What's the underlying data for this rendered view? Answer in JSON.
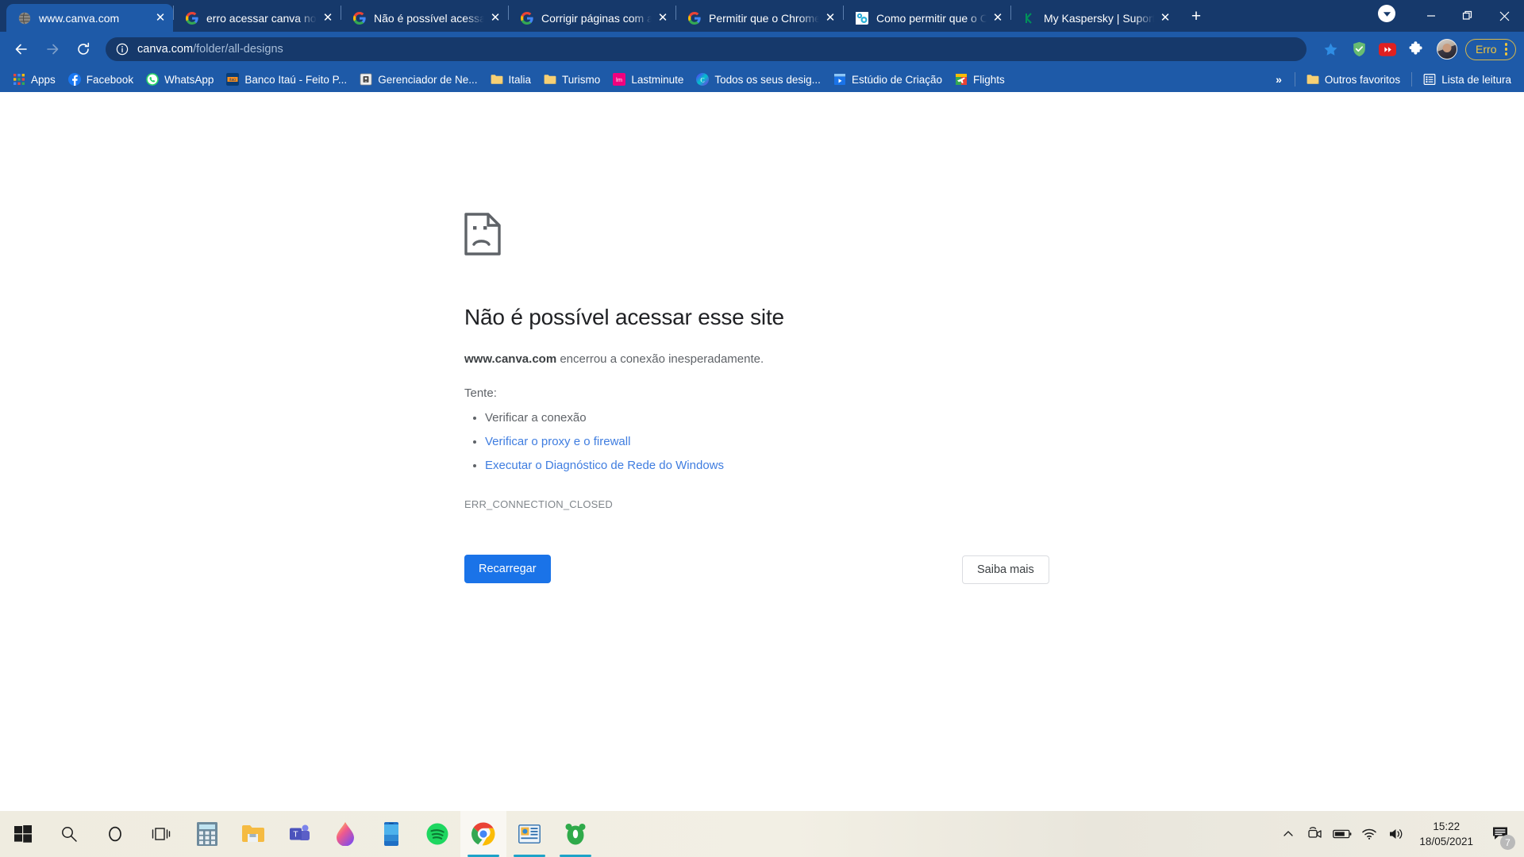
{
  "window": {
    "minimize_label": "Minimizar",
    "restore_label": "Restaurar",
    "close_label": "Fechar"
  },
  "tabs": [
    {
      "title": "www.canva.com",
      "favicon": "globe-icon",
      "active": true
    },
    {
      "title": "erro acessar canva no",
      "favicon": "google-icon",
      "active": false
    },
    {
      "title": "Não é possível acessa",
      "favicon": "google-icon",
      "active": false
    },
    {
      "title": "Corrigir páginas com a",
      "favicon": "google-icon",
      "active": false
    },
    {
      "title": "Permitir que o Chrome",
      "favicon": "google-icon",
      "active": false
    },
    {
      "title": "Como permitir que o C",
      "favicon": "settings-blue-icon",
      "active": false
    },
    {
      "title": "My Kaspersky | Suport",
      "favicon": "kaspersky-icon",
      "active": false
    }
  ],
  "tabstrip": {
    "new_tab_label": "+",
    "tab_search_label": "Pesquisar guias"
  },
  "toolbar": {
    "back_label": "Voltar",
    "forward_label": "Avançar",
    "reload_label": "Recarregar esta página",
    "url_host": "canva.com",
    "url_path": "/folder/all-designs",
    "site_info_label": "Informações do site",
    "bookmark_star_label": "Favoritar",
    "icons": [
      "adguard-shield-icon",
      "youtube-red-icon",
      "extensions-puzzle-icon"
    ],
    "profile_label": "Perfil",
    "error_button_label": "Erro",
    "menu_label": "Personalizar e controlar o Google Chrome"
  },
  "bookmarks": {
    "items": [
      {
        "label": "Apps",
        "icon": "apps-grid-icon"
      },
      {
        "label": "Facebook",
        "icon": "facebook-icon"
      },
      {
        "label": "WhatsApp",
        "icon": "whatsapp-icon"
      },
      {
        "label": "Banco Itaú - Feito P...",
        "icon": "itau-icon"
      },
      {
        "label": "Gerenciador de Ne...",
        "icon": "manager-icon"
      },
      {
        "label": "Italia",
        "icon": "folder-icon"
      },
      {
        "label": "Turismo",
        "icon": "folder-icon"
      },
      {
        "label": "Lastminute",
        "icon": "lastminute-icon"
      },
      {
        "label": "Todos os seus desig...",
        "icon": "canva-icon"
      },
      {
        "label": "Estúdio de Criação",
        "icon": "studio-icon"
      },
      {
        "label": "Flights",
        "icon": "google-flights-icon"
      }
    ],
    "overflow_label": "»",
    "other_label": "Outros favoritos",
    "other_icon": "folder-icon",
    "reading_list_label": "Lista de leitura",
    "reading_list_icon": "reading-list-icon"
  },
  "error_page": {
    "icon": "sad-page-icon",
    "title": "Não é possível acessar esse site",
    "host": "www.canva.com",
    "subtitle_rest": " encerrou a conexão inesperadamente.",
    "try_label": "Tente:",
    "suggestions": [
      {
        "text": "Verificar a conexão",
        "link": false
      },
      {
        "text": "Verificar o proxy e o firewall",
        "link": true
      },
      {
        "text": "Executar o Diagnóstico de Rede do Windows",
        "link": true
      }
    ],
    "error_code": "ERR_CONNECTION_CLOSED",
    "reload_button": "Recarregar",
    "learn_more_button": "Saiba mais"
  },
  "taskbar": {
    "items": [
      {
        "name": "start-button",
        "icon": "windows-logo-icon",
        "running": false,
        "active": false
      },
      {
        "name": "search-button",
        "icon": "search-icon",
        "running": false,
        "active": false
      },
      {
        "name": "cortana-button",
        "icon": "cortana-circle-icon",
        "running": false,
        "active": false
      },
      {
        "name": "task-view-button",
        "icon": "task-view-icon",
        "running": false,
        "active": false
      },
      {
        "name": "calculator-app",
        "icon": "calculator-icon",
        "running": false,
        "active": false
      },
      {
        "name": "file-explorer-app",
        "icon": "folder-icon",
        "running": false,
        "active": false
      },
      {
        "name": "microsoft-teams-app",
        "icon": "teams-icon",
        "running": false,
        "active": false
      },
      {
        "name": "paint-3d-app",
        "icon": "droplet-icon",
        "running": false,
        "active": false
      },
      {
        "name": "your-phone-app",
        "icon": "phone-icon",
        "running": false,
        "active": false
      },
      {
        "name": "spotify-app",
        "icon": "spotify-icon",
        "running": false,
        "active": false
      },
      {
        "name": "google-chrome-app",
        "icon": "chrome-icon",
        "running": true,
        "active": true
      },
      {
        "name": "presentation-app",
        "icon": "presentation-icon",
        "running": true,
        "active": false
      },
      {
        "name": "bear-app",
        "icon": "bear-icon",
        "running": true,
        "active": false
      }
    ],
    "tray": {
      "show_hidden_label": "Mostrar ícones ocultos",
      "icons": [
        "meeting-camera-icon",
        "battery-icon",
        "wifi-icon",
        "volume-icon"
      ],
      "time": "15:22",
      "date": "18/05/2021",
      "notification_icon": "notification-icon",
      "notification_count": "7"
    }
  }
}
